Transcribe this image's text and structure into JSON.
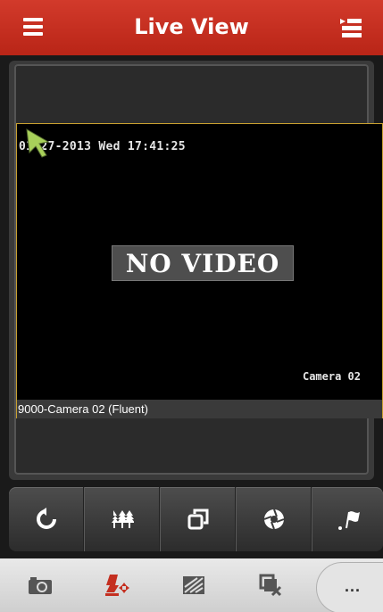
{
  "header": {
    "title": "Live View",
    "menu_icon": "hamburger-icon",
    "right_icon": "channel-list-icon",
    "color": "#c42f20"
  },
  "video": {
    "timestamp": "01-27-2013 Wed 17:41:25",
    "no_video_text": "NO VIDEO",
    "camera_osd": "Camera 02",
    "channel_label": "9000-Camera 02 (Fluent)",
    "selection_border_color": "#c8a030"
  },
  "controls": [
    {
      "icon": "refresh-icon"
    },
    {
      "icon": "split-screen-icon"
    },
    {
      "icon": "window-switch-icon"
    },
    {
      "icon": "aperture-icon"
    },
    {
      "icon": "flag-icon"
    }
  ],
  "bottom_tabs": [
    {
      "icon": "camera-icon"
    },
    {
      "icon": "ptz-icon"
    },
    {
      "icon": "image-quality-icon"
    },
    {
      "icon": "close-window-icon"
    },
    {
      "icon": "more-icon",
      "label": "..."
    }
  ]
}
